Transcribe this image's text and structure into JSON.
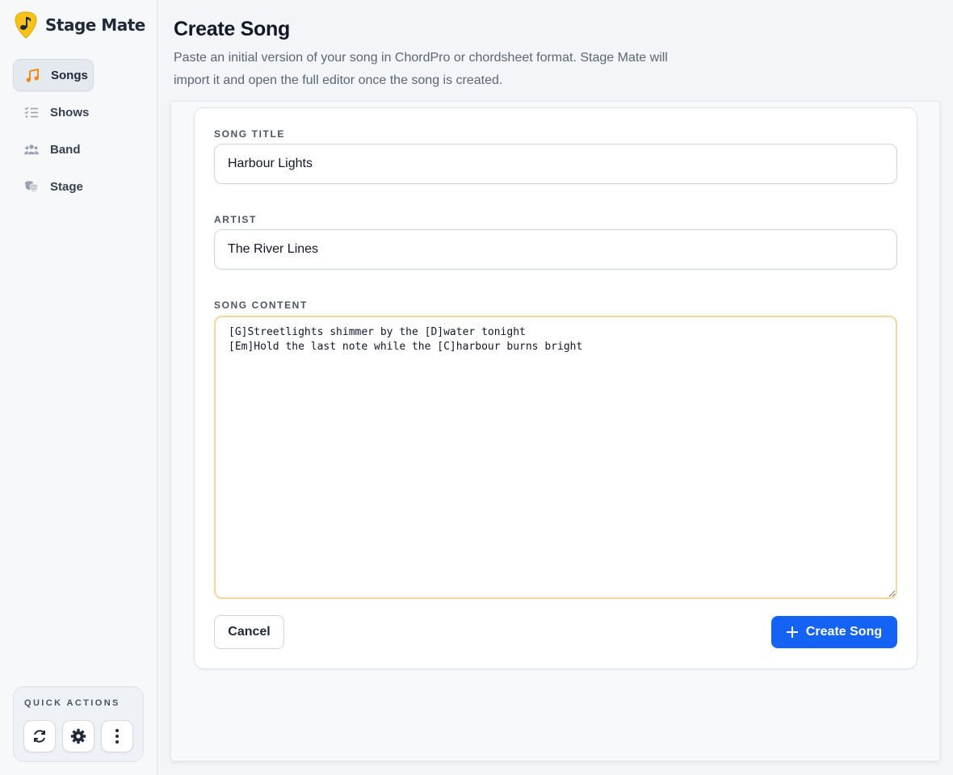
{
  "app": {
    "name": "Stage Mate",
    "logo_icon": "guitar-pick-music-note-icon",
    "brand_color": "#f7c21a"
  },
  "sidebar": {
    "items": [
      {
        "label": "Songs",
        "icon": "music-note-icon",
        "active": true
      },
      {
        "label": "Shows",
        "icon": "checklist-icon",
        "active": false
      },
      {
        "label": "Band",
        "icon": "users-icon",
        "active": false
      },
      {
        "label": "Stage",
        "icon": "theater-masks-icon",
        "active": false
      }
    ],
    "quick_actions": {
      "title": "QUICK ACTIONS",
      "buttons": [
        {
          "icon": "refresh-icon"
        },
        {
          "icon": "gear-icon"
        },
        {
          "icon": "more-vertical-icon"
        }
      ]
    }
  },
  "header": {
    "title": "Create Song",
    "subtitle": "Paste an initial version of your song in ChordPro or chordsheet format. Stage Mate will import it and open the full editor once the song is created."
  },
  "form": {
    "title_label": "SONG TITLE",
    "title_value": "Harbour Lights",
    "artist_label": "ARTIST",
    "artist_value": "The River Lines",
    "content_label": "SONG CONTENT",
    "content_value": "[G]Streetlights shimmer by the [D]water tonight\n[Em]Hold the last note while the [C]harbour burns bright",
    "cancel_label": "Cancel",
    "create_label": "Create Song"
  },
  "colors": {
    "accent": "#1463f5",
    "focus_border": "#f2d79b",
    "songs_icon": "#f08a12"
  }
}
